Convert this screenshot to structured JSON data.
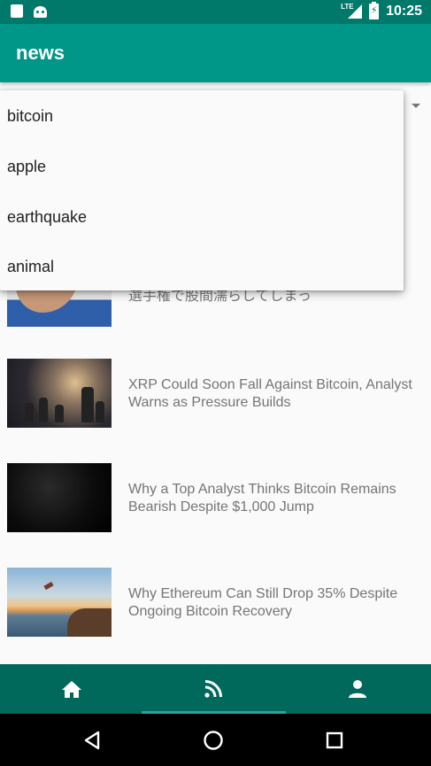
{
  "status_bar": {
    "network_label": "LTE",
    "time": "10:25"
  },
  "app_bar": {
    "title": "news"
  },
  "dropdown": {
    "options": [
      "bitcoin",
      "apple",
      "earthquake",
      "animal"
    ]
  },
  "news": [
    {
      "title": "選手権で股間濡らしてしまっ",
      "image_icon": "arm-photo"
    },
    {
      "title": "XRP Could Soon Fall Against Bitcoin, Analyst Warns as Pressure Builds",
      "image_icon": "chess-photo"
    },
    {
      "title": "Why a Top Analyst Thinks Bitcoin Remains Bearish Despite $1,000 Jump",
      "image_icon": "dark-water-photo"
    },
    {
      "title": "Why Ethereum Can Still Drop 35% Despite Ongoing Bitcoin Recovery",
      "image_icon": "cliff-jump-photo"
    }
  ],
  "bottom_nav": {
    "items": [
      {
        "icon": "home-icon"
      },
      {
        "icon": "rss-feed-icon",
        "active": true
      },
      {
        "icon": "person-icon"
      }
    ]
  },
  "system_nav": {
    "icons": [
      "back-icon",
      "home-circle-icon",
      "recents-icon"
    ]
  },
  "colors": {
    "status_bar": "#00796b",
    "app_bar": "#009688",
    "bottom_nav": "#00695c",
    "active_indicator": "#26a69a"
  }
}
